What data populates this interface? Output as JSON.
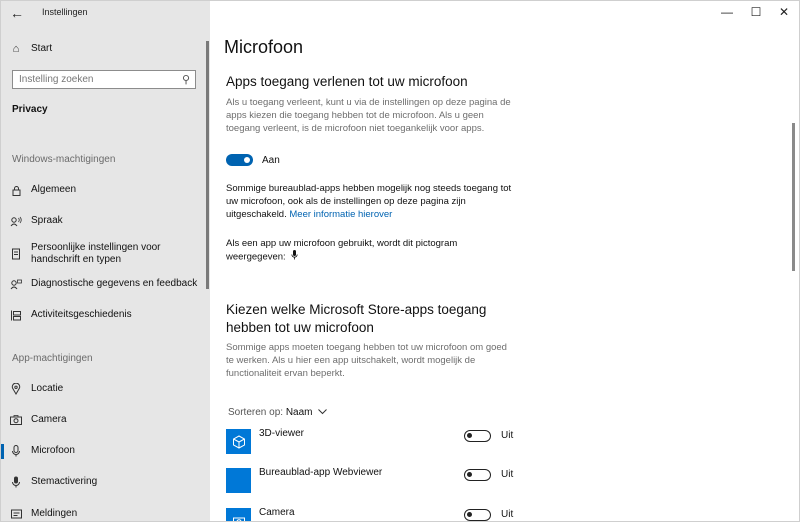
{
  "window": {
    "title": "Instellingen",
    "back_icon": "arrow-left-icon",
    "controls": {
      "minimize": "—",
      "maximize": "☐",
      "close": "✕"
    }
  },
  "sidebar": {
    "home": {
      "label": "Start",
      "icon": "home-icon"
    },
    "search": {
      "placeholder": "Instelling zoeken",
      "icon": "search-icon"
    },
    "category": "Privacy",
    "section_windows": "Windows-machtigingen",
    "windows_items": [
      {
        "label": "Algemeen",
        "icon": "lock-icon"
      },
      {
        "label": "Spraak",
        "icon": "speech-icon"
      },
      {
        "label": "Persoonlijke instellingen voor handschrift en typen",
        "icon": "handwriting-icon"
      },
      {
        "label": "Diagnostische gegevens en feedback",
        "icon": "feedback-icon"
      },
      {
        "label": "Activiteitsgeschiedenis",
        "icon": "timeline-icon"
      }
    ],
    "section_app": "App-machtigingen",
    "app_items": [
      {
        "label": "Locatie",
        "icon": "location-icon"
      },
      {
        "label": "Camera",
        "icon": "camera-icon"
      },
      {
        "label": "Microfoon",
        "icon": "microphone-icon",
        "selected": true
      },
      {
        "label": "Stemactivering",
        "icon": "voice-activation-icon"
      },
      {
        "label": "Meldingen",
        "icon": "notification-icon"
      }
    ]
  },
  "main": {
    "title": "Microfoon",
    "section1": {
      "heading": "Apps toegang verlenen tot uw microfoon",
      "description": "Als u toegang verleent, kunt u via de instellingen op deze pagina de apps kiezen die toegang hebben tot de microfoon. Als u geen toegang verleent, is de microfoon niet toegankelijk voor apps.",
      "toggle_state": "on",
      "toggle_label": "Aan",
      "desktop_note": "Sommige bureaublad-apps hebben mogelijk nog steeds toegang tot uw microfoon, ook als de instellingen op deze pagina zijn uitgeschakeld.",
      "link": "Meer informatie hierover",
      "icon_note": "Als een app uw microfoon gebruikt, wordt dit pictogram weergegeven:",
      "icon_note_icon": "microphone-icon"
    },
    "section2": {
      "heading_line1": "Kiezen welke Microsoft Store-apps toegang",
      "heading_line2": "hebben tot uw microfoon",
      "description": "Sommige apps moeten toegang hebben tot uw microfoon om goed te werken. Als u hier een app uitschakelt, wordt mogelijk de functionaliteit ervan beperkt."
    },
    "sort": {
      "label": "Sorteren op:",
      "value": "Naam"
    },
    "apps": [
      {
        "name": "3D-viewer",
        "state": "off",
        "state_label": "Uit",
        "icon": "cube-icon"
      },
      {
        "name": "Bureaublad-app Webviewer",
        "state": "off",
        "state_label": "Uit",
        "icon": "webviewer-icon"
      },
      {
        "name": "Camera",
        "state": "off",
        "state_label": "Uit",
        "icon": "camera-app-icon"
      }
    ]
  },
  "colors": {
    "accent": "#0063b1",
    "sidebar_bg": "#e6e6e6",
    "tile": "#0078d7"
  }
}
